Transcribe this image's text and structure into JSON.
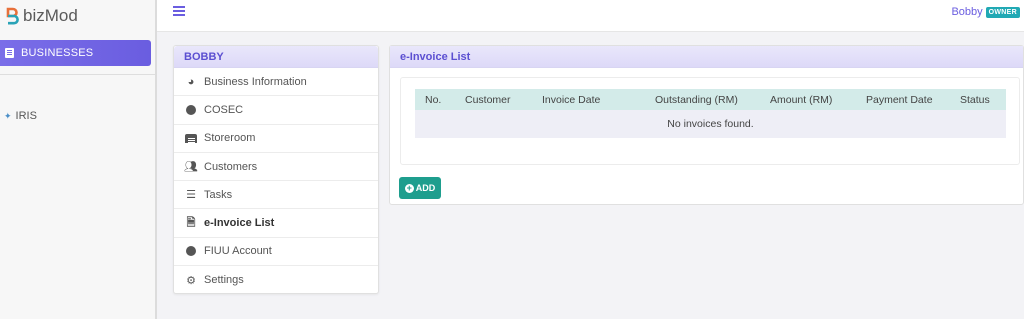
{
  "brand": {
    "name": "bizMod"
  },
  "sidebar": {
    "items": [
      {
        "label": "BUSINESSES",
        "icon": "building-icon"
      },
      {
        "label": "IRIS",
        "icon": "iris-icon"
      }
    ]
  },
  "topbar": {
    "user": "Bobby",
    "role_badge": "OWNER"
  },
  "menu": {
    "header": "BOBBY",
    "items": [
      {
        "label": "Business Information",
        "icon": "dashboard-icon"
      },
      {
        "label": "COSEC",
        "icon": "user-circle-icon"
      },
      {
        "label": "Storeroom",
        "icon": "warehouse-icon"
      },
      {
        "label": "Customers",
        "icon": "users-icon"
      },
      {
        "label": "Tasks",
        "icon": "tasks-icon"
      },
      {
        "label": "e-Invoice List",
        "icon": "file-invoice-icon"
      },
      {
        "label": "FIUU Account",
        "icon": "user-circle-icon"
      },
      {
        "label": "Settings",
        "icon": "gear-icon"
      }
    ]
  },
  "invoice": {
    "title": "e-Invoice List",
    "columns": [
      "No.",
      "Customer",
      "Invoice Date",
      "Outstanding (RM)",
      "Amount (RM)",
      "Payment Date",
      "Status"
    ],
    "empty_message": "No invoices found.",
    "add_label": "ADD"
  },
  "colors": {
    "accent": "#6a5de0",
    "teal": "#1e9e8e",
    "badge": "#21a9b4"
  }
}
